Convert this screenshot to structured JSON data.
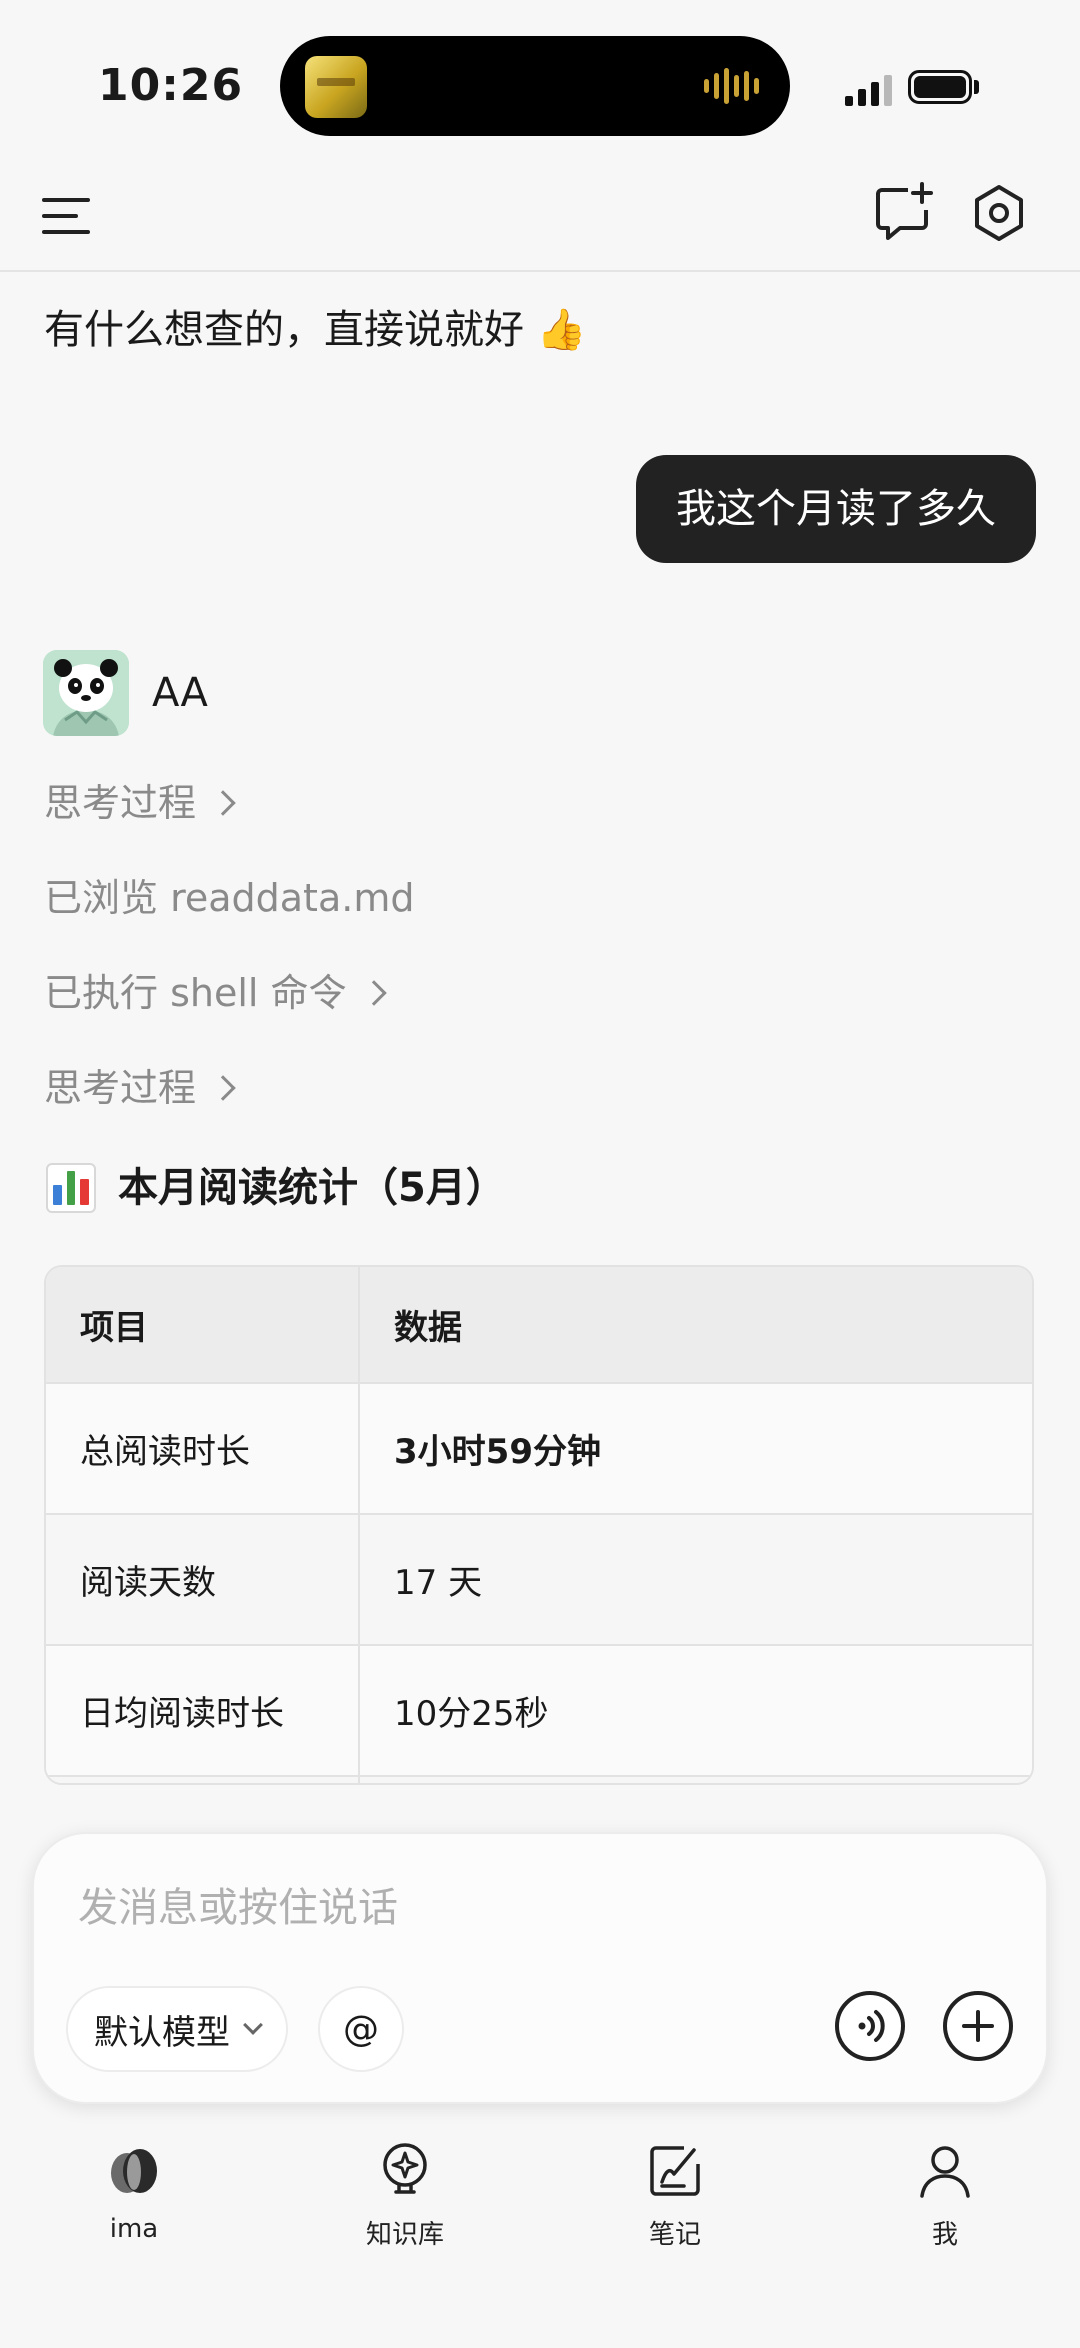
{
  "status_bar": {
    "time": "10:26",
    "icons": [
      "dynamic-island-now-playing",
      "cellular-signal-icon",
      "battery-icon"
    ]
  },
  "header": {
    "icons": [
      "menu-icon",
      "new-chat-icon",
      "settings-icon"
    ]
  },
  "chat": {
    "greeting": "有什么想查的，直接说就好 👍",
    "user_message": "我这个月读了多久",
    "assistant": {
      "name": "AA",
      "avatar": "panda-avatar",
      "steps": [
        {
          "label": "思考过程",
          "expandable": true
        },
        {
          "label": "已浏览 readdata.md",
          "expandable": false
        },
        {
          "label": "已执行 shell 命令",
          "expandable": true
        },
        {
          "label": "思考过程",
          "expandable": true
        }
      ],
      "section_title": "本月阅读统计（5月）",
      "section_icon": "bar-chart-emoji"
    },
    "table": {
      "headers": [
        "项目",
        "数据"
      ],
      "rows": [
        {
          "item": "总阅读时长",
          "value": "3小时59分钟"
        },
        {
          "item": "阅读天数",
          "value": "17 天"
        },
        {
          "item": "日均阅读时长",
          "value": "10分25秒"
        }
      ]
    }
  },
  "composer": {
    "placeholder": "发消息或按住说话",
    "value": "",
    "model_label": "默认模型",
    "mention_label": "@",
    "icons": [
      "voice-icon",
      "plus-icon"
    ]
  },
  "bottom_nav": {
    "items": [
      {
        "label": "ima",
        "icon": "ima-logo-icon"
      },
      {
        "label": "知识库",
        "icon": "knowledge-base-icon"
      },
      {
        "label": "笔记",
        "icon": "notes-icon"
      },
      {
        "label": "我",
        "icon": "profile-icon"
      }
    ]
  }
}
